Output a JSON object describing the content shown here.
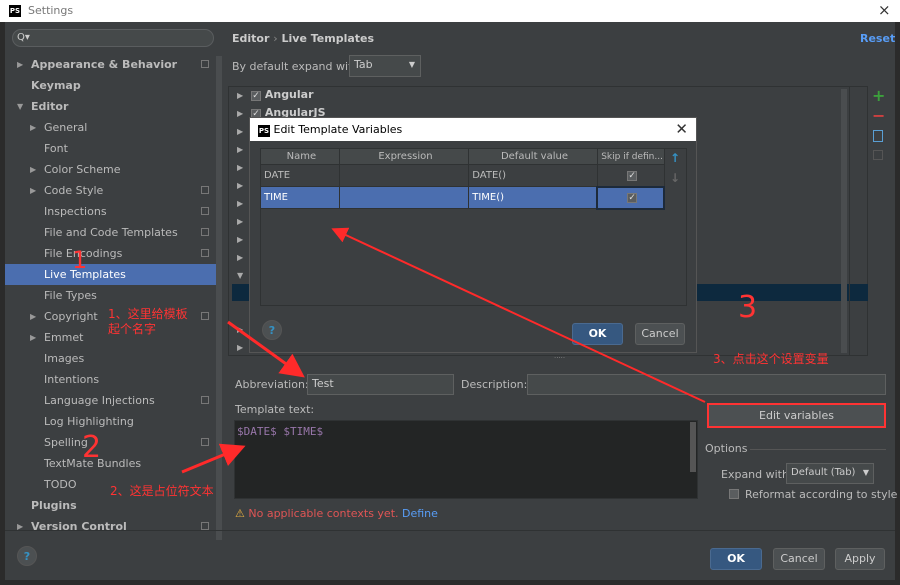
{
  "window": {
    "title": "Settings",
    "close": "×"
  },
  "sidebar": {
    "search_icon": "Q▾",
    "items": [
      {
        "label": "Appearance & Behavior"
      },
      {
        "label": "Keymap"
      },
      {
        "label": "Editor"
      },
      {
        "label": "General"
      },
      {
        "label": "Font"
      },
      {
        "label": "Color Scheme"
      },
      {
        "label": "Code Style"
      },
      {
        "label": "Inspections"
      },
      {
        "label": "File and Code Templates"
      },
      {
        "label": "File Encodings"
      },
      {
        "label": "Live Templates"
      },
      {
        "label": "File Types"
      },
      {
        "label": "Copyright"
      },
      {
        "label": "Emmet"
      },
      {
        "label": "Images"
      },
      {
        "label": "Intentions"
      },
      {
        "label": "Language Injections"
      },
      {
        "label": "Log Highlighting"
      },
      {
        "label": "Spelling"
      },
      {
        "label": "TextMate Bundles"
      },
      {
        "label": "TODO"
      },
      {
        "label": "Plugins"
      },
      {
        "label": "Version Control"
      }
    ]
  },
  "main": {
    "breadcrumb": [
      "Editor",
      "Live Templates"
    ],
    "breadcrumb_sep": "›",
    "reset": "Reset",
    "expand_label": "By default expand with",
    "expand_value": "Tab",
    "tree": [
      {
        "label": "Angular",
        "checked": true
      },
      {
        "label": "AngularJS",
        "checked": true
      }
    ],
    "abbreviation_label": "Abbreviation:",
    "abbreviation_value": "Test",
    "description_label": "Description:",
    "description_value": "",
    "template_text_label": "Template text:",
    "template_text": "$DATE$ $TIME$",
    "edit_variables": "Edit variables",
    "options_label": "Options",
    "expand_with_label": "Expand with",
    "expand_with_value": "Default (Tab)",
    "reformat_label": "Reformat according to style",
    "reformat_checked": false,
    "warning": "No applicable contexts yet.",
    "define_link": "Define"
  },
  "dialog": {
    "title": "Edit Template Variables",
    "columns": [
      "Name",
      "Expression",
      "Default value",
      "Skip if defin..."
    ],
    "rows": [
      {
        "name": "DATE",
        "expression": "",
        "default": "DATE()",
        "skip": true
      },
      {
        "name": "TIME",
        "expression": "",
        "default": "TIME()",
        "skip": true
      }
    ],
    "ok": "OK",
    "cancel": "Cancel",
    "help": "?"
  },
  "footer": {
    "ok": "OK",
    "cancel": "Cancel",
    "apply": "Apply",
    "help": "?"
  },
  "annotations": {
    "n1": "1",
    "n2": "2",
    "n3": "3",
    "note1a": "1、这里给模板",
    "note1b": "起个名字",
    "note2": "2、这是占位符文本",
    "note3": "3、点击这个设置变量"
  },
  "colors": {
    "selection": "#4b6eaf",
    "annotation": "#ff2a2a",
    "link": "#589df6",
    "add": "#3ca03c",
    "remove": "#d04040"
  }
}
